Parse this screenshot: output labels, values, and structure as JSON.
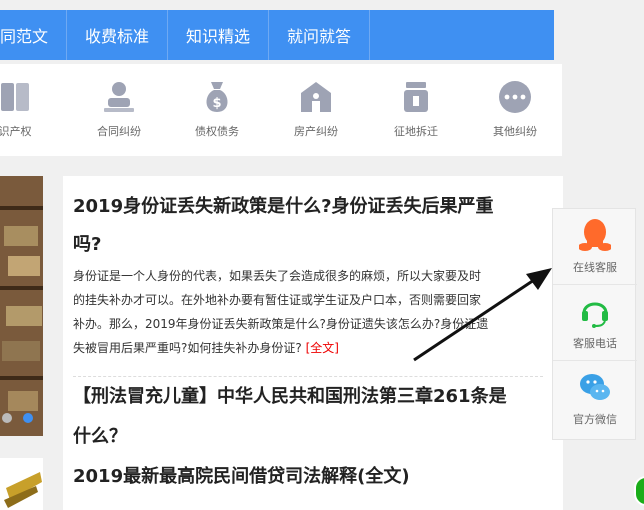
{
  "nav": {
    "items": [
      {
        "label": "合同范文"
      },
      {
        "label": "收费标准"
      },
      {
        "label": "知识精选"
      },
      {
        "label": "就问就答"
      }
    ]
  },
  "categories": [
    {
      "label": "识产权",
      "icon": "book-icon"
    },
    {
      "label": "合同纠纷",
      "icon": "person-stamp-icon"
    },
    {
      "label": "债权债务",
      "icon": "money-bag-icon"
    },
    {
      "label": "房产纠纷",
      "icon": "house-icon"
    },
    {
      "label": "征地拆迁",
      "icon": "demolition-icon"
    },
    {
      "label": "其他纠纷",
      "icon": "more-icon"
    }
  ],
  "articles": {
    "a1_title_l1": "2019身份证丢失新政策是什么?身份证丢失后果严重",
    "a1_title_l2": "吗?",
    "a1_body": [
      "身份证是一个人身份的代表，如果丢失了会造成很多的麻烦，所以大家要及时",
      "的挂失补办才可以。在外地补办要有暂住证或学生证及户口本，否则需要回家",
      "补办。那么，2019年身份证丢失新政策是什么?身份证遗失该怎么办?身份证遗",
      "失被冒用后果严重吗?如何挂失补办身份证?"
    ],
    "a1_more": "[全文]",
    "a2_title_l1": "【刑法冒充儿童】中华人民共和国刑法第三章261条是",
    "a2_title_l2": "什么？",
    "a3_title": "2019最新最高院民间借贷司法解释(全文)"
  },
  "service": [
    {
      "label": "在线客服",
      "icon": "qq-penguin-icon"
    },
    {
      "label": "客服电话",
      "icon": "headset-icon"
    },
    {
      "label": "官方微信",
      "icon": "wechat-icon"
    }
  ],
  "colors": {
    "nav_bg": "#3f90f2",
    "icon_gray": "#9ea3b4",
    "accent_blue": "#3f90f2",
    "qq_orange": "#ff6a2b",
    "headset_green": "#22bb44",
    "wechat_blue": "#3aa0e6",
    "link_red": "#ee0000"
  }
}
